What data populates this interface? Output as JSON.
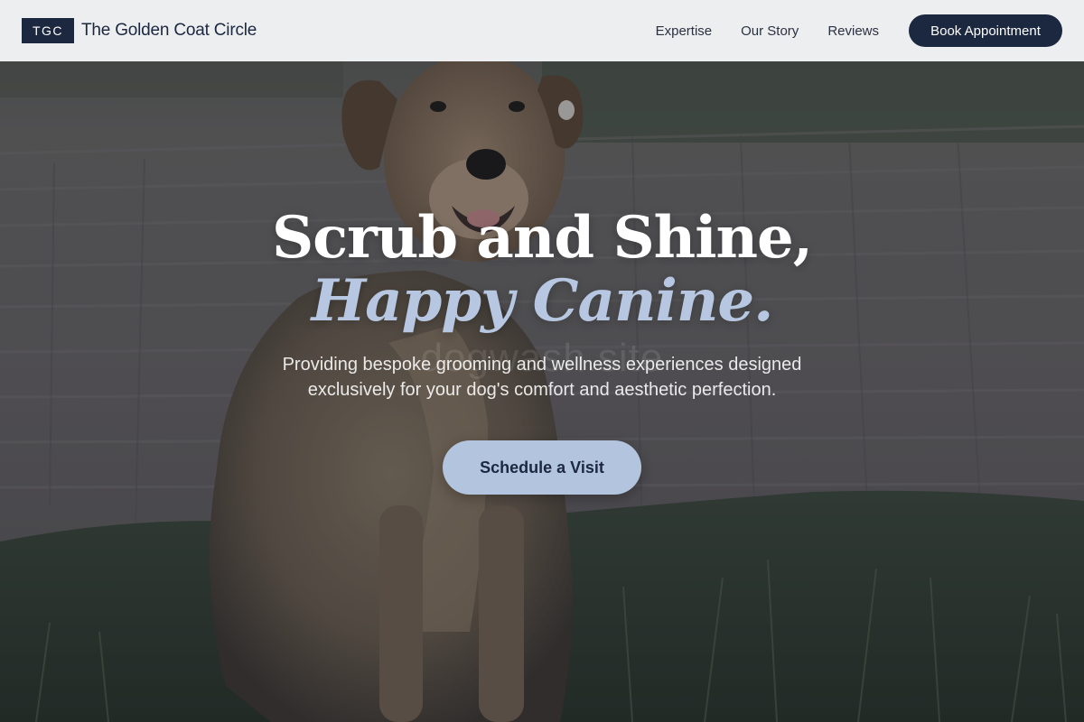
{
  "header": {
    "logo_mark": "TGC",
    "brand_name": "The Golden Coat Circle",
    "nav": [
      {
        "label": "Expertise"
      },
      {
        "label": "Our Story"
      },
      {
        "label": "Reviews"
      }
    ],
    "book_label": "Book Appointment"
  },
  "hero": {
    "title_line1": "Scrub and Shine,",
    "title_line2": "Happy Canine.",
    "watermark": "dogwash.site",
    "subtitle": "Providing bespoke grooming and wellness experiences designed exclusively for your dog's comfort and aesthetic perfection.",
    "cta_label": "Schedule a Visit",
    "background_image": "dog-sitting-on-grass-photo"
  },
  "colors": {
    "navy": "#1c2740",
    "accent_blue": "#b3c4df",
    "header_bg": "#f3f4f6"
  }
}
